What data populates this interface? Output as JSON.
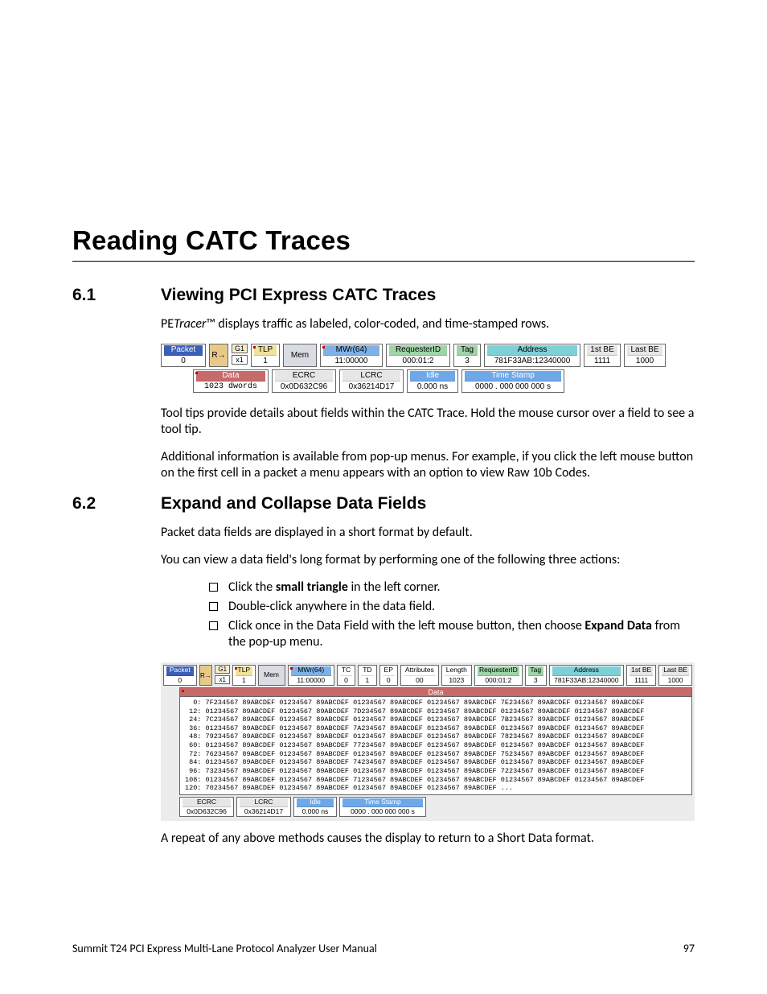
{
  "chapterTitle": "Reading CATC Traces",
  "section61": {
    "num": "6.1",
    "title": "Viewing PCI Express CATC Traces",
    "p1_a": "PE",
    "p1_b": "Tracer",
    "p1_c": "™ displays traffic as labeled, color-coded, and time-stamped rows.",
    "p2": "Tool tips provide details about fields within the CATC Trace. Hold the mouse cursor over a field to see a tool tip.",
    "p3": "Additional information is available from pop-up menus. For example, if you click the left mouse button on the first cell in a packet a menu appears with an option to view Raw 10b Codes."
  },
  "section62": {
    "num": "6.2",
    "title": "Expand and Collapse Data Fields",
    "p1": "Packet data fields are displayed in a short format by default.",
    "p2": "You can view a data field's long format by performing one of the following three actions:",
    "li1a": "Click the ",
    "li1b": "small triangle",
    "li1c": " in the left corner.",
    "li2": "Double-click anywhere in the data field.",
    "li3a": "Click once in the Data Field with the left mouse button, then choose ",
    "li3b": "Expand Data",
    "li3c": " from the pop-up menu.",
    "p3": "A repeat of any above methods causes the display to return to a Short Data format."
  },
  "trace1": {
    "packet": {
      "label": "Packet",
      "value": "0"
    },
    "arrow": "R→",
    "g1": "G1",
    "x1": "x1",
    "tlp": {
      "label": "TLP",
      "value": "1"
    },
    "mem": "Mem",
    "mwr": {
      "label": "MWr(64)",
      "value": "11:00000"
    },
    "req": {
      "label": "RequesterID",
      "value": "000:01:2"
    },
    "tag": {
      "label": "Tag",
      "value": "3"
    },
    "addr": {
      "label": "Address",
      "value": "781F33AB:12340000"
    },
    "be1": {
      "label": "1st BE",
      "value": "1111"
    },
    "be2": {
      "label": "Last BE",
      "value": "1000"
    },
    "data": {
      "label": "Data",
      "value": "1023 dwords"
    },
    "ecrc": {
      "label": "ECRC",
      "value": "0x0D632C96"
    },
    "lcrc": {
      "label": "LCRC",
      "value": "0x36214D17"
    },
    "idle": {
      "label": "Idle",
      "value": "0.000 ns"
    },
    "ts": {
      "label": "Time Stamp",
      "value": "0000 . 000 000 000 s"
    }
  },
  "trace2": {
    "packet": {
      "label": "Packet",
      "value": "0"
    },
    "arrow": "R→",
    "g1": "G1",
    "x1": "x1",
    "tlp": {
      "label": "TLP",
      "value": "1"
    },
    "mem": "Mem",
    "mwr": {
      "label": "MWr(64)",
      "value": "11:00000"
    },
    "tc": {
      "label": "TC",
      "value": "0"
    },
    "td": {
      "label": "TD",
      "value": "1"
    },
    "ep": {
      "label": "EP",
      "value": "0"
    },
    "attr": {
      "label": "Attributes",
      "value": "00"
    },
    "len": {
      "label": "Length",
      "value": "1023"
    },
    "req": {
      "label": "RequesterID",
      "value": "000:01:2"
    },
    "tag": {
      "label": "Tag",
      "value": "3"
    },
    "addr": {
      "label": "Address",
      "value": "781F33AB:12340000"
    },
    "be1": {
      "label": "1st BE",
      "value": "1111"
    },
    "be2": {
      "label": "Last BE",
      "value": "1000"
    },
    "dataLabel": "Data",
    "hex": "  0: 7F234567 89ABCDEF 01234567 89ABCDEF 01234567 89ABCDEF 01234567 89ABCDEF 7E234567 89ABCDEF 01234567 89ABCDEF\n 12: 01234567 89ABCDEF 01234567 89ABCDEF 7D234567 89ABCDEF 01234567 89ABCDEF 01234567 89ABCDEF 01234567 89ABCDEF\n 24: 7C234567 89ABCDEF 01234567 89ABCDEF 01234567 89ABCDEF 01234567 89ABCDEF 7B234567 89ABCDEF 01234567 89ABCDEF\n 36: 01234567 89ABCDEF 01234567 89ABCDEF 7A234567 89ABCDEF 01234567 89ABCDEF 01234567 89ABCDEF 01234567 89ABCDEF\n 48: 79234567 89ABCDEF 01234567 89ABCDEF 01234567 89ABCDEF 01234567 89ABCDEF 78234567 89ABCDEF 01234567 89ABCDEF\n 60: 01234567 89ABCDEF 01234567 89ABCDEF 77234567 89ABCDEF 01234567 89ABCDEF 01234567 89ABCDEF 01234567 89ABCDEF\n 72: 76234567 89ABCDEF 01234567 89ABCDEF 01234567 89ABCDEF 01234567 89ABCDEF 75234567 89ABCDEF 01234567 89ABCDEF\n 84: 01234567 89ABCDEF 01234567 89ABCDEF 74234567 89ABCDEF 01234567 89ABCDEF 01234567 89ABCDEF 01234567 89ABCDEF\n 96: 73234567 89ABCDEF 01234567 89ABCDEF 01234567 89ABCDEF 01234567 89ABCDEF 72234567 89ABCDEF 01234567 89ABCDEF\n108: 01234567 89ABCDEF 01234567 89ABCDEF 71234567 89ABCDEF 01234567 89ABCDEF 01234567 89ABCDEF 01234567 89ABCDEF\n120: 70234567 89ABCDEF 01234567 89ABCDEF 01234567 89ABCDEF 01234567 89ABCDEF ...",
    "ecrc": {
      "label": "ECRC",
      "value": "0x0D632C96"
    },
    "lcrc": {
      "label": "LCRC",
      "value": "0x36214D17"
    },
    "idle": {
      "label": "Idle",
      "value": "0.000 ns"
    },
    "ts": {
      "label": "Time Stamp",
      "value": "0000 . 000 000 000 s"
    }
  },
  "footer": {
    "left": "Summit T24 PCI Express Multi-Lane Protocol Analyzer User Manual",
    "right": "97"
  }
}
